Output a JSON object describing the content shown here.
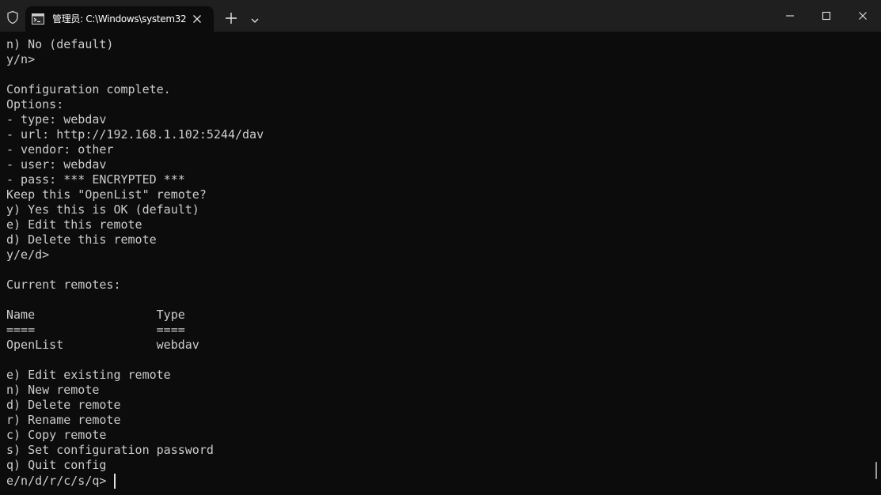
{
  "window": {
    "tab_title": "管理员: C:\\Windows\\system32",
    "icons": {
      "shield": "shield-icon",
      "tab": "terminal-icon",
      "tab_close": "close-icon",
      "new_tab": "plus-icon",
      "dropdown": "chevron-down-icon",
      "minimize": "minimize-icon",
      "maximize": "maximize-icon",
      "close": "close-icon"
    }
  },
  "terminal": {
    "output": "n) No (default)\ny/n>\n\nConfiguration complete.\nOptions:\n- type: webdav\n- url: http://192.168.1.102:5244/dav\n- vendor: other\n- user: webdav\n- pass: *** ENCRYPTED ***\nKeep this \"OpenList\" remote?\ny) Yes this is OK (default)\ne) Edit this remote\nd) Delete this remote\ny/e/d>\n\nCurrent remotes:\n\nName                 Type\n====                 ====\nOpenList             webdav\n\ne) Edit existing remote\nn) New remote\nd) Delete remote\nr) Rename remote\nc) Copy remote\ns) Set configuration password\nq) Quit config",
    "prompt": "e/n/d/r/c/s/q> "
  },
  "colors": {
    "background": "#0c0c0c",
    "titlebar": "#1f1f1f",
    "text": "#cccccc"
  }
}
